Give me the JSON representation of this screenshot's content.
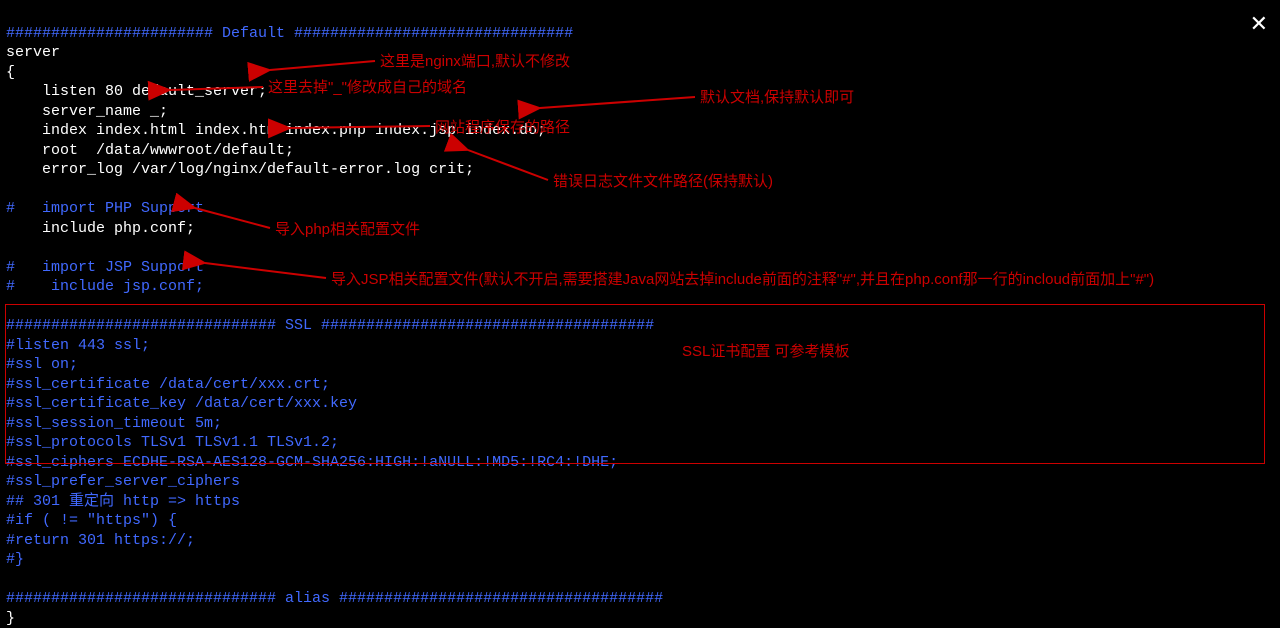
{
  "close_icon": "✕",
  "config": {
    "header_default": "####################### Default ###############################",
    "server_open": "server",
    "brace_open": "{",
    "listen": "    listen 80 default_server;",
    "server_name": "    server_name _;",
    "index": "    index index.html index.htm index.php index.jsp index.do;",
    "root": "    root  /data/wwwroot/default;",
    "error_log": "    error_log /var/log/nginx/default-error.log crit;",
    "blank": "",
    "import_php_comment": "#   import PHP Support",
    "include_php": "    include php.conf;",
    "import_jsp_comment": "#   import JSP Support",
    "include_jsp": "#    include jsp.conf;",
    "ssl_header": "############################## SSL #####################################",
    "ssl_listen": "#listen 443 ssl;",
    "ssl_on": "#ssl on;",
    "ssl_cert": "#ssl_certificate /data/cert/xxx.crt;",
    "ssl_cert_key": "#ssl_certificate_key /data/cert/xxx.key",
    "ssl_session": "#ssl_session_timeout 5m;",
    "ssl_protocols": "#ssl_protocols TLSv1 TLSv1.1 TLSv1.2;",
    "ssl_ciphers": "#ssl_ciphers ECDHE-RSA-AES128-GCM-SHA256:HIGH:!aNULL:!MD5:!RC4:!DHE;",
    "ssl_prefer": "#ssl_prefer_server_ciphers",
    "redirect_301": "## 301 重定向 http => https",
    "if_cond": "#if ( != \"https\") {",
    "return_301": "#return 301 https://;",
    "brace_close_comment": "#}",
    "alias_header": "############################## alias ####################################",
    "brace_close": "}"
  },
  "annotations": {
    "port": "这里是nginx端口,默认不修改",
    "server_name": "这里去掉\"_\"修改成自己的域名",
    "default_doc": "默认文档,保持默认即可",
    "website_root": "网站程序保存的路径",
    "error_log": "错误日志文件文件路径(保持默认)",
    "php_config": "导入php相关配置文件",
    "jsp_config": "导入JSP相关配置文件(默认不开启,需要搭建Java网站去掉include前面的注释\"#\",并且在php.conf那一行的incloud前面加上\"#\")",
    "ssl_template": "SSL证书配置 可参考模板"
  }
}
